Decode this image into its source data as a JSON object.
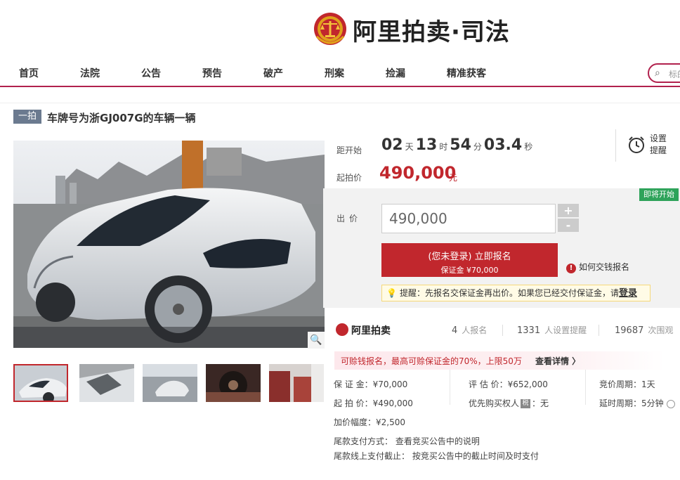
{
  "header": {
    "logo_text": "阿里拍卖·司法"
  },
  "nav": {
    "items": [
      "首页",
      "法院",
      "公告",
      "预告",
      "破产",
      "刑案",
      "捡漏",
      "精准获客"
    ],
    "search_placeholder": "标的"
  },
  "listing": {
    "tag": "一拍",
    "title": "车牌号为浙GJ007G的车辆一辆"
  },
  "countdown": {
    "label": "距开始",
    "days": "02",
    "days_unit": "天",
    "hours": "13",
    "hours_unit": "时",
    "minutes": "54",
    "minutes_unit": "分",
    "seconds": "03.4",
    "seconds_unit": "秒"
  },
  "reminder": {
    "label": "设置提醒"
  },
  "start_price": {
    "label": "起拍价",
    "value": "490,000",
    "unit": "元"
  },
  "bid": {
    "status_badge": "即将开始",
    "label": "出价",
    "value": "490,000",
    "plus": "+",
    "minus": "-",
    "register_line1": "(您未登录) 立即报名",
    "register_line2": "保证金 ¥70,000",
    "how_pay": "如何交钱报名",
    "tip_prefix": "提醒：先报名交保证金再出价。如果您已经交付保证金，请",
    "tip_login": "登录"
  },
  "stats": {
    "brand": "阿里拍卖",
    "registrations": "4",
    "registrations_unit": "人报名",
    "reminders": "1331",
    "reminders_unit": "人设置提醒",
    "views": "19687",
    "views_unit": "次围观"
  },
  "promo": {
    "text": "可赊钱报名，最高可赊保证金的70%，上限50万",
    "link": "查看详情 〉"
  },
  "details": {
    "deposit": "保 证 金：¥70,000",
    "start": "起 拍 价：¥490,000",
    "increment": "加价幅度：¥2,500",
    "appraisal": "评 估 价：¥652,000",
    "priority": "优先购买权人",
    "priority_tag": "税",
    "priority_value": "：无",
    "cycle": "竞价周期：1天",
    "delay": "延时周期：5分钟",
    "tail_payment_method": "尾款支付方式：  查看竞买公告中的说明",
    "tail_payment_deadline": "尾款线上支付截止：  按竞买公告中的截止时间及时支付"
  },
  "colors": {
    "brand_red": "#c1272d",
    "nav_line": "#b1214d",
    "green_badge": "#2ea35a"
  }
}
